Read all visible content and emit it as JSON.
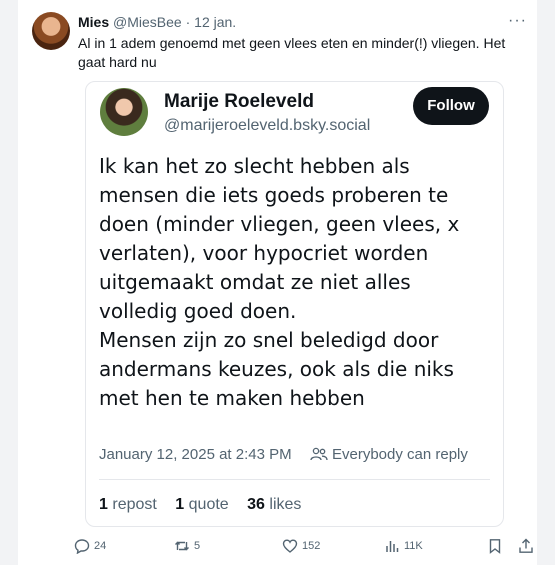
{
  "tweet": {
    "author_name": "Mies",
    "author_handle": "@MiesBee",
    "separator": " · ",
    "date": "12 jan.",
    "more": "···",
    "text": "Al in 1 adem genoemd met geen vlees eten en minder(!) vliegen. Het gaat hard nu"
  },
  "embed": {
    "name": "Marije Roeleveld",
    "handle": "@marijeroeleveld.bsky.social",
    "follow_label": "Follow",
    "paragraphs": [
      "Ik kan het zo slecht hebben als mensen die iets goeds proberen te doen (minder vliegen, geen vlees, x verlaten), voor hypocriet worden uitgemaakt omdat ze niet alles volledig goed doen.",
      "Mensen zijn zo snel beledigd door andermans keuzes, ook als die niks met hen te maken hebben"
    ],
    "timestamp": "January 12, 2025 at 2:43 PM",
    "reply_setting": "Everybody can reply",
    "stats": {
      "reposts_count": "1",
      "reposts_label": "repost",
      "quotes_count": "1",
      "quotes_label": "quote",
      "likes_count": "36",
      "likes_label": "likes"
    }
  },
  "actions": {
    "replies": "24",
    "reposts": "5",
    "likes": "152",
    "views": "11K"
  },
  "colors": {
    "text": "#0f1419",
    "muted": "#536471",
    "border": "#e5e7eb",
    "follow_bg": "#0f1419"
  }
}
